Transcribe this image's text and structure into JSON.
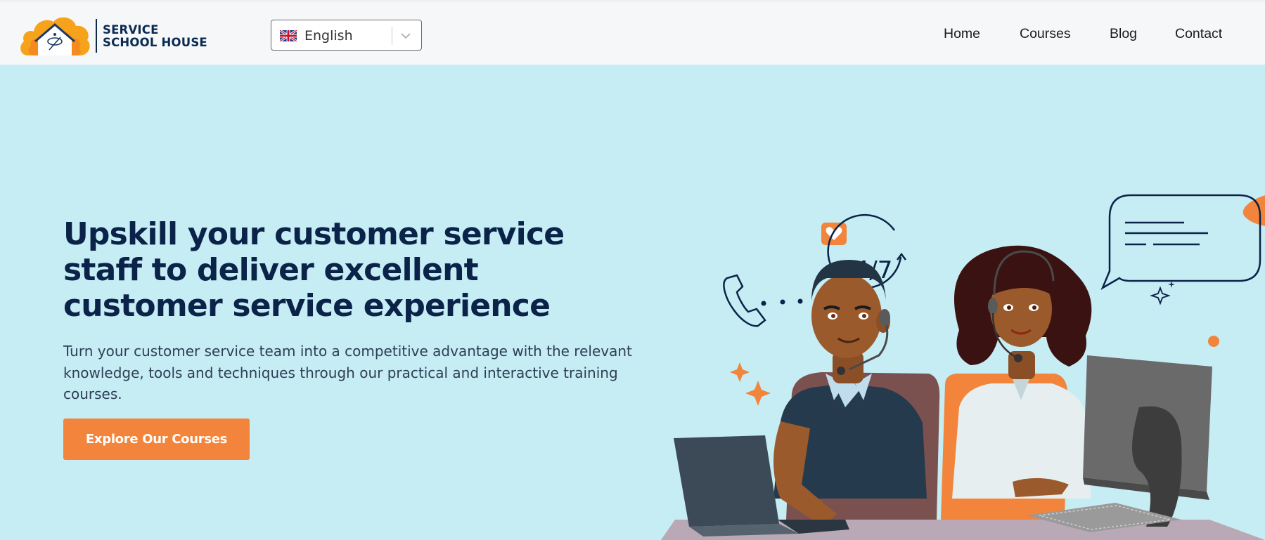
{
  "header": {
    "logo": {
      "line1": "SERVICE",
      "line2": "SCHOOL HOUSE"
    },
    "language": {
      "selected": "English",
      "flag_icon": "uk-flag-icon"
    },
    "nav": [
      {
        "label": "Home"
      },
      {
        "label": "Courses"
      },
      {
        "label": "Blog"
      },
      {
        "label": "Contact"
      }
    ]
  },
  "hero": {
    "headline": "Upskill your customer service staff to deliver excellent customer service experience",
    "subtext": "Turn your customer service team into a competitive advantage with the relevant knowledge, tools and techniques through our practical and interactive training courses.",
    "cta_label": "Explore Our Courses",
    "illustration": {
      "badge_247": "24/7"
    }
  },
  "colors": {
    "header_bg": "#f6f7f9",
    "hero_bg": "#c6ecf4",
    "accent": "#f2843b",
    "navy": "#0b2349"
  }
}
